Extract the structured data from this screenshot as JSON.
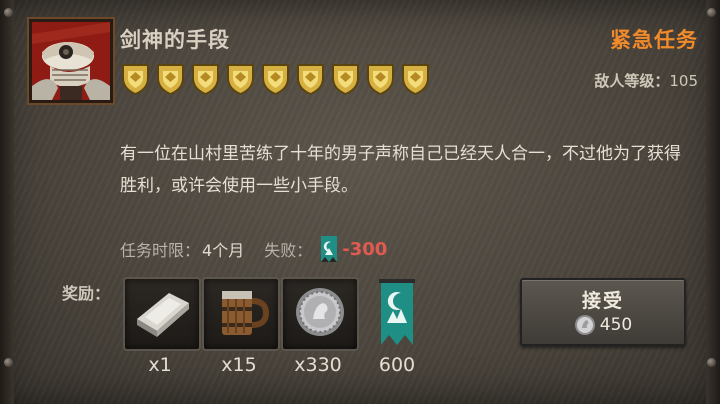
{
  "quest": {
    "title": "剑神的手段",
    "tag": "紧急任务",
    "enemy_level_label": "敌人等级：",
    "enemy_level": "105",
    "rank_shields": 9,
    "description": "有一位在山村里苦练了十年的男子声称自己已经天人合一，不过他为了获得胜利，或许会使用一些小手段。",
    "duration_label": "任务时限：",
    "duration_value": "4个月",
    "fail_label": "失败：",
    "fail_penalty": "-300"
  },
  "rewards": {
    "label": "奖励：",
    "items": [
      {
        "icon": "silver-ingot-icon",
        "qty": "x1"
      },
      {
        "icon": "wooden-mug-icon",
        "qty": "x15"
      },
      {
        "icon": "silver-coin-icon",
        "qty": "x330"
      },
      {
        "icon": "faction-banner-icon",
        "qty": "600"
      }
    ]
  },
  "accept": {
    "label": "接受",
    "cost": "450"
  },
  "colors": {
    "urgent": "#f08a2a",
    "penalty": "#e05a4f",
    "banner": "#1f8f86",
    "shield_gold": "#d6b040"
  }
}
